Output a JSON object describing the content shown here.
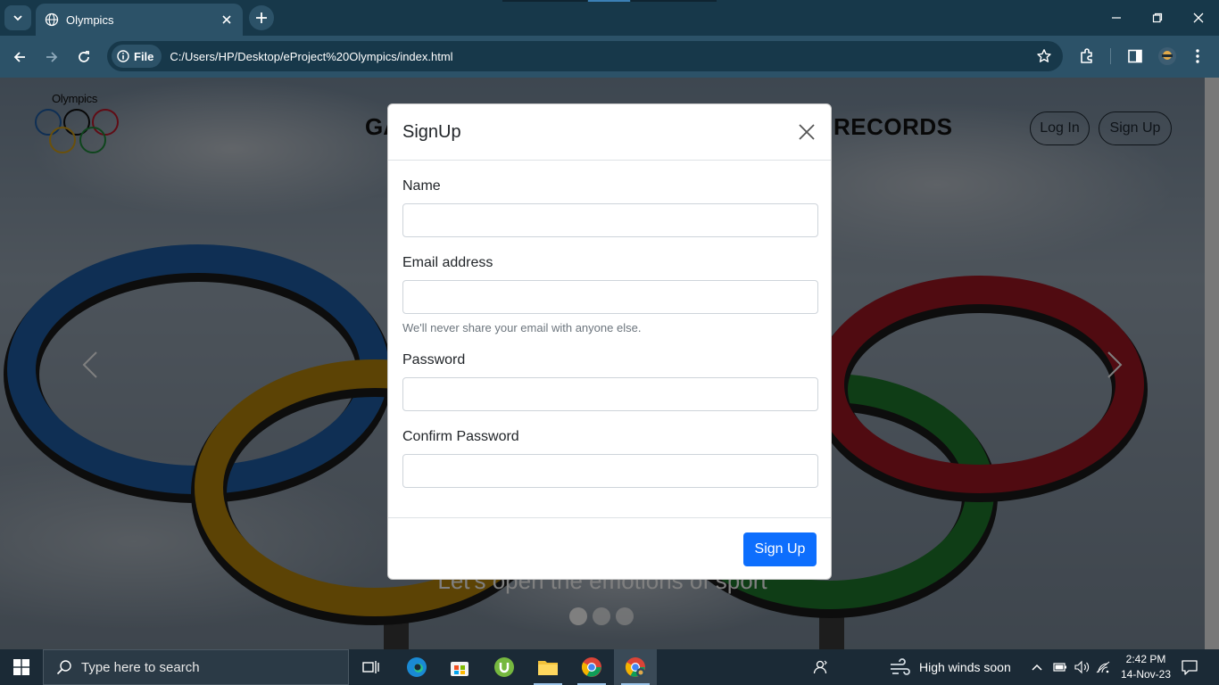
{
  "browser": {
    "tab": {
      "title": "Olympics"
    },
    "address": {
      "chip_label": "File",
      "url": "C:/Users/HP/Desktop/eProject%20Olympics/index.html"
    }
  },
  "page": {
    "logo_text": "Olympics",
    "nav_left": "GA",
    "nav_right": "RECORDS",
    "login_button": "Log In",
    "signup_button": "Sign Up",
    "caption": "Let's open the emotions of sport",
    "carousel": {
      "slides": 3,
      "active": 1
    }
  },
  "modal": {
    "title": "SignUp",
    "fields": {
      "name": {
        "label": "Name",
        "value": ""
      },
      "email": {
        "label": "Email address",
        "value": "",
        "help": "We'll never share your email with anyone else."
      },
      "password": {
        "label": "Password",
        "value": ""
      },
      "confirm": {
        "label": "Confirm Password",
        "value": ""
      }
    },
    "submit_label": "Sign Up"
  },
  "taskbar": {
    "search_placeholder": "Type here to search",
    "weather": "High winds soon",
    "time": "2:42 PM",
    "date": "14-Nov-23"
  },
  "colors": {
    "chrome_dark": "#17384a",
    "chrome_toolbar": "#2c5268",
    "primary_button": "#0d6efd",
    "ring_blue": "#1f5fa8",
    "ring_yellow": "#b8860b",
    "ring_black": "#1a1a1a",
    "ring_green": "#1f7a2c",
    "ring_red": "#a01622"
  }
}
